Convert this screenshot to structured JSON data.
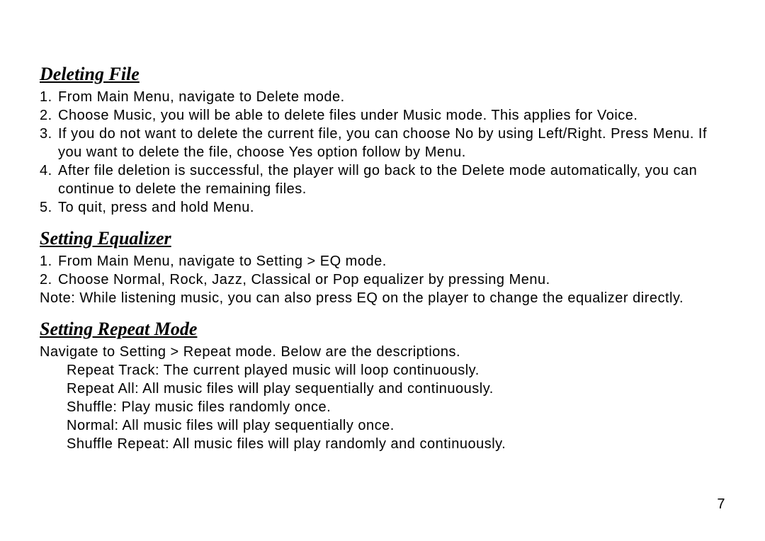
{
  "section1": {
    "title": "Deleting File",
    "items": [
      {
        "num": "1.",
        "text": "From Main Menu, navigate to Delete mode."
      },
      {
        "num": "2.",
        "text": "Choose Music, you will be able to delete files under Music mode. This applies for Voice."
      },
      {
        "num": "3.",
        "text": "If you do not want to delete the current file, you can choose No by using Left/Right. Press Menu. If you want to delete the file, choose Yes option follow by Menu."
      },
      {
        "num": "4.",
        "text": "After file deletion is successful, the player will go back to the Delete mode automatically, you can continue to delete the remaining files."
      },
      {
        "num": "5.",
        "text": "To quit, press and hold Menu."
      }
    ]
  },
  "section2": {
    "title": "Setting Equalizer",
    "items": [
      {
        "num": "1.",
        "text": "From Main Menu, navigate to Setting > EQ mode."
      },
      {
        "num": "2.",
        "text": "Choose Normal, Rock, Jazz, Classical or Pop equalizer by pressing Menu."
      }
    ],
    "note": "Note: While listening music, you can also press EQ on the player to change the equalizer directly."
  },
  "section3": {
    "title": "Setting Repeat Mode",
    "intro": "Navigate to Setting > Repeat mode. Below are the descriptions.",
    "lines": [
      "Repeat Track: The current played music will loop continuously.",
      "Repeat All: All music files will play sequentially and continuously.",
      "Shuffle: Play music files randomly once.",
      "Normal: All music files will play sequentially once.",
      "Shuffle Repeat: All music files will play randomly and continuously."
    ]
  },
  "page_number": "7"
}
